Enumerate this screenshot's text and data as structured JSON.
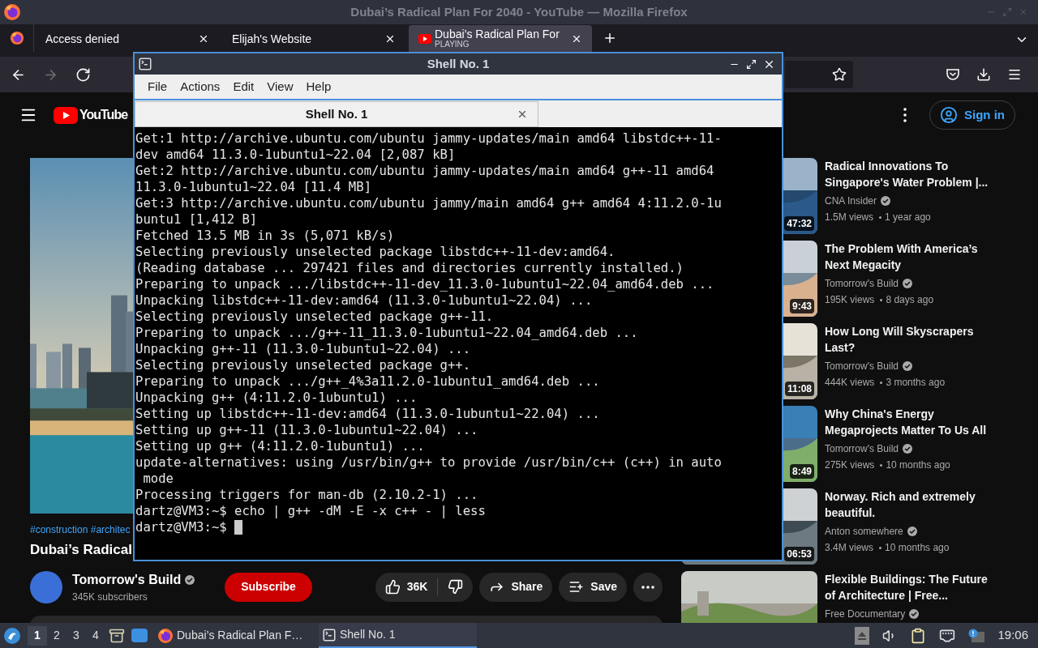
{
  "firefox": {
    "title": "Dubai’s Radical Plan For 2040 - YouTube — Mozilla Firefox",
    "tabs": [
      {
        "label": "Access denied",
        "selected": false
      },
      {
        "label": "Elijah's Website",
        "selected": false
      },
      {
        "label": "Dubai’s Radical Plan For",
        "status": "PLAYING",
        "selected": true
      }
    ],
    "nav_buttons": [
      {
        "kind": "back",
        "disabled": false
      },
      {
        "kind": "forward",
        "disabled": true
      },
      {
        "kind": "reload",
        "disabled": false
      }
    ]
  },
  "youtube": {
    "logo": "YouTube",
    "sign_in": "Sign in",
    "video": {
      "hashtags": "#construction #architec",
      "title": "Dubai’s Radical",
      "channel": "Tomorrow's Build",
      "subscribers": "345K subscribers",
      "subscribe": "Subscribe",
      "likes": "36K",
      "share": "Share",
      "save": "Save"
    },
    "recommendations": [
      {
        "title": "Radical Innovations To Singapore's Water Problem |...",
        "channel": "CNA Insider",
        "views": "1.5M views",
        "age": "1 year ago",
        "duration": "47:32"
      },
      {
        "title": "The Problem With America’s Next Megacity",
        "channel": "Tomorrow's Build",
        "views": "195K views",
        "age": "8 days ago",
        "duration": "9:43"
      },
      {
        "title": "How Long Will Skyscrapers Last?",
        "channel": "Tomorrow's Build",
        "views": "444K views",
        "age": "3 months ago",
        "duration": "11:08"
      },
      {
        "title": "Why China's Energy Megaprojects Matter To Us All",
        "channel": "Tomorrow's Build",
        "views": "275K views",
        "age": "10 months ago",
        "duration": "8:49"
      },
      {
        "title": "Norway. Rich and extremely beautiful.",
        "channel": "Anton somewhere",
        "views": "3.4M views",
        "age": "10 months ago",
        "duration": "06:53"
      },
      {
        "title": "Flexible Buildings: The Future of Architecture | Free...",
        "channel": "Free Documentary"
      }
    ]
  },
  "terminal": {
    "title": "Shell No. 1",
    "menu": [
      "File",
      "Actions",
      "Edit",
      "View",
      "Help"
    ],
    "tabs": [
      {
        "label": "Shell No. 1",
        "selected": true
      }
    ],
    "lines": [
      "Get:1 http://archive.ubuntu.com/ubuntu jammy-updates/main amd64 libstdc++-11-",
      "dev amd64 11.3.0-1ubuntu1~22.04 [2,087 kB]",
      "Get:2 http://archive.ubuntu.com/ubuntu jammy-updates/main amd64 g++-11 amd64",
      "11.3.0-1ubuntu1~22.04 [11.4 MB]",
      "Get:3 http://archive.ubuntu.com/ubuntu jammy/main amd64 g++ amd64 4:11.2.0-1u",
      "buntu1 [1,412 B]",
      "Fetched 13.5 MB in 3s (5,071 kB/s)",
      "Selecting previously unselected package libstdc++-11-dev:amd64.",
      "(Reading database ... 297421 files and directories currently installed.)",
      "Preparing to unpack .../libstdc++-11-dev_11.3.0-1ubuntu1~22.04_amd64.deb ...",
      "Unpacking libstdc++-11-dev:amd64 (11.3.0-1ubuntu1~22.04) ...",
      "Selecting previously unselected package g++-11.",
      "Preparing to unpack .../g++-11_11.3.0-1ubuntu1~22.04_amd64.deb ...",
      "Unpacking g++-11 (11.3.0-1ubuntu1~22.04) ...",
      "Selecting previously unselected package g++.",
      "Preparing to unpack .../g++_4%3a11.2.0-1ubuntu1_amd64.deb ...",
      "Unpacking g++ (4:11.2.0-1ubuntu1) ...",
      "Setting up libstdc++-11-dev:amd64 (11.3.0-1ubuntu1~22.04) ...",
      "Setting up g++-11 (11.3.0-1ubuntu1~22.04) ...",
      "Setting up g++ (4:11.2.0-1ubuntu1) ...",
      "update-alternatives: using /usr/bin/g++ to provide /usr/bin/c++ (c++) in auto",
      " mode",
      "Processing triggers for man-db (2.10.2-1) ...",
      "dartz@VM3:~$ echo | g++ -dM -E -x c++ - | less",
      "dartz@VM3:~$"
    ]
  },
  "taskbar": {
    "workspaces": [
      {
        "label": "1",
        "selected": true
      },
      {
        "label": "2",
        "selected": false
      },
      {
        "label": "3",
        "selected": false
      },
      {
        "label": "4",
        "selected": false
      }
    ],
    "tasks": [
      {
        "kind": "browser",
        "label": "Dubai’s Radical Plan F…",
        "selected": false
      },
      {
        "kind": "terminal",
        "label": "Shell No. 1",
        "selected": true
      }
    ],
    "clock": "19:06"
  }
}
